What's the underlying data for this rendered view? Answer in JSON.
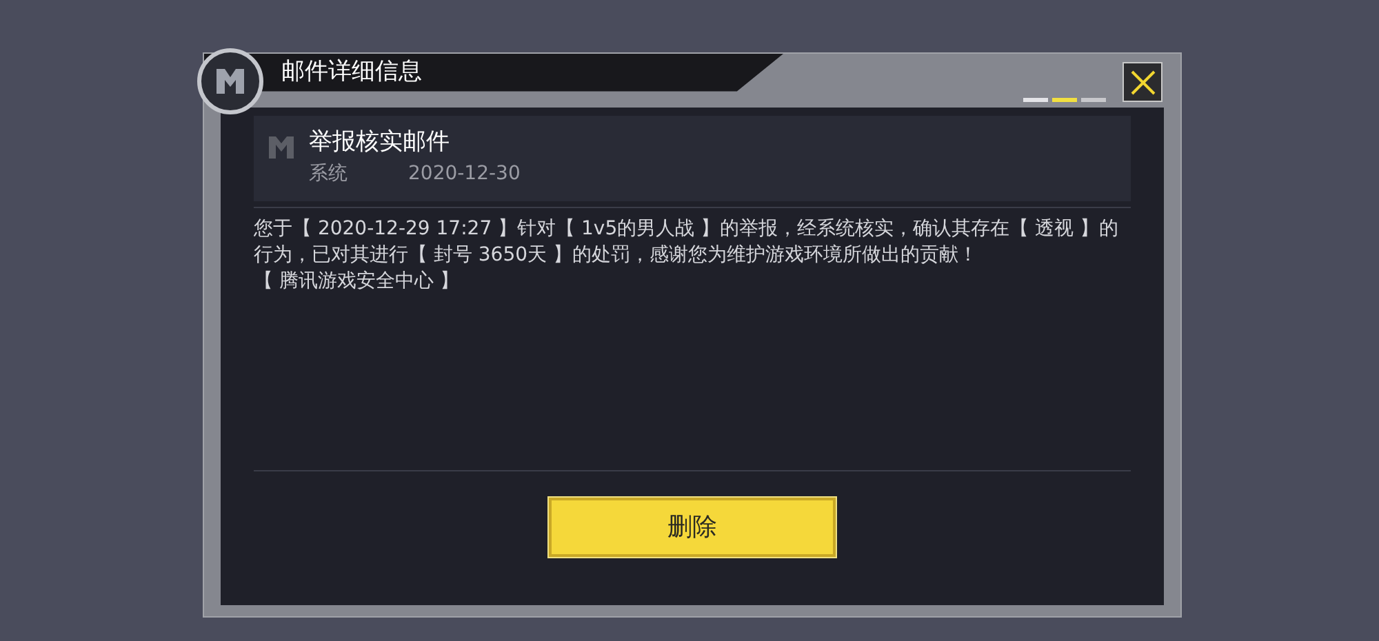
{
  "dialog": {
    "title": "邮件详细信息",
    "mail": {
      "subject": "举报核实邮件",
      "sender": "系统",
      "date": "2020-12-30",
      "body": [
        "您于【 2020-12-29 17:27 】针对【 1v5的男人战 】的举报，经系统核实，确认其存在【 透视 】的行为，已对其进行【 封号 3650天 】的处罚，感谢您为维护游戏环境所做出的贡献！",
        "【 腾讯游戏安全中心 】"
      ]
    },
    "delete_button": "删除"
  }
}
